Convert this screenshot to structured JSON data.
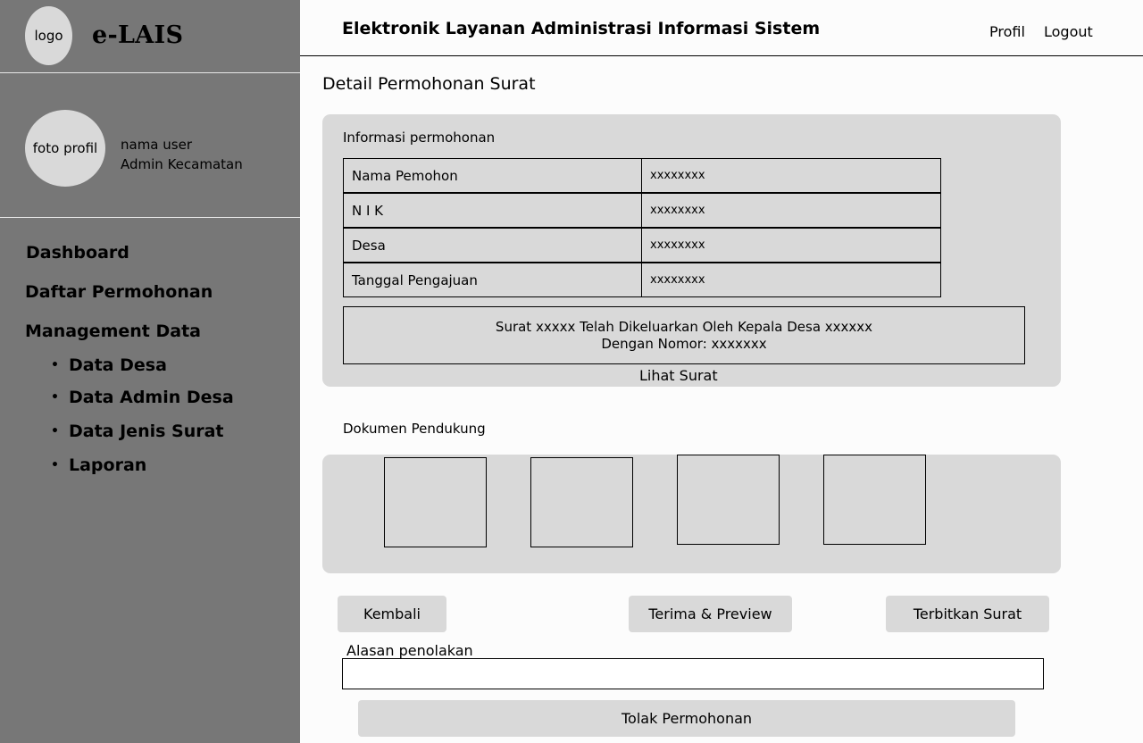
{
  "sidebar": {
    "logo": "logo",
    "app_name": "e-LAIS",
    "avatar": "foto profil",
    "user_name": "nama user",
    "user_role": "Admin Kecamatan",
    "nav": {
      "dashboard": "Dashboard",
      "daftar": "Daftar Permohonan",
      "management": "Management Data",
      "sub": [
        "Data Desa",
        "Data Admin Desa",
        "Data Jenis Surat",
        "Laporan"
      ],
      "bullet": "•"
    }
  },
  "header": {
    "title": "Elektronik Layanan Administrasi Informasi Sistem",
    "profil": "Profil",
    "logout": "Logout"
  },
  "main": {
    "page_title": "Detail Permohonan Surat",
    "info": {
      "label": "Informasi permohonan",
      "rows": [
        {
          "key": "Nama Pemohon",
          "value": "xxxxxxxx"
        },
        {
          "key": "N I K",
          "value": "xxxxxxxx"
        },
        {
          "key": "Desa",
          "value": "xxxxxxxx"
        },
        {
          "key": "Tanggal Pengajuan",
          "value": "xxxxxxxx"
        }
      ],
      "notice_line1": "Surat xxxxx Telah Dikeluarkan Oleh Kepala Desa xxxxxx",
      "notice_line2": "Dengan Nomor: xxxxxxx",
      "lihat_surat": "Lihat Surat"
    },
    "documents": {
      "label": "Dokumen Pendukung"
    },
    "buttons": {
      "kembali": "Kembali",
      "terima": "Terima & Preview",
      "terbitkan": "Terbitkan Surat",
      "tolak": "Tolak Permohonan"
    },
    "reason": {
      "label": "Alasan penolakan",
      "value": "",
      "placeholder": ""
    }
  },
  "colors": {
    "sidebar_bg": "#777777",
    "panel_bg": "#d9d9d9",
    "page_bg": "#fcfcfc"
  }
}
